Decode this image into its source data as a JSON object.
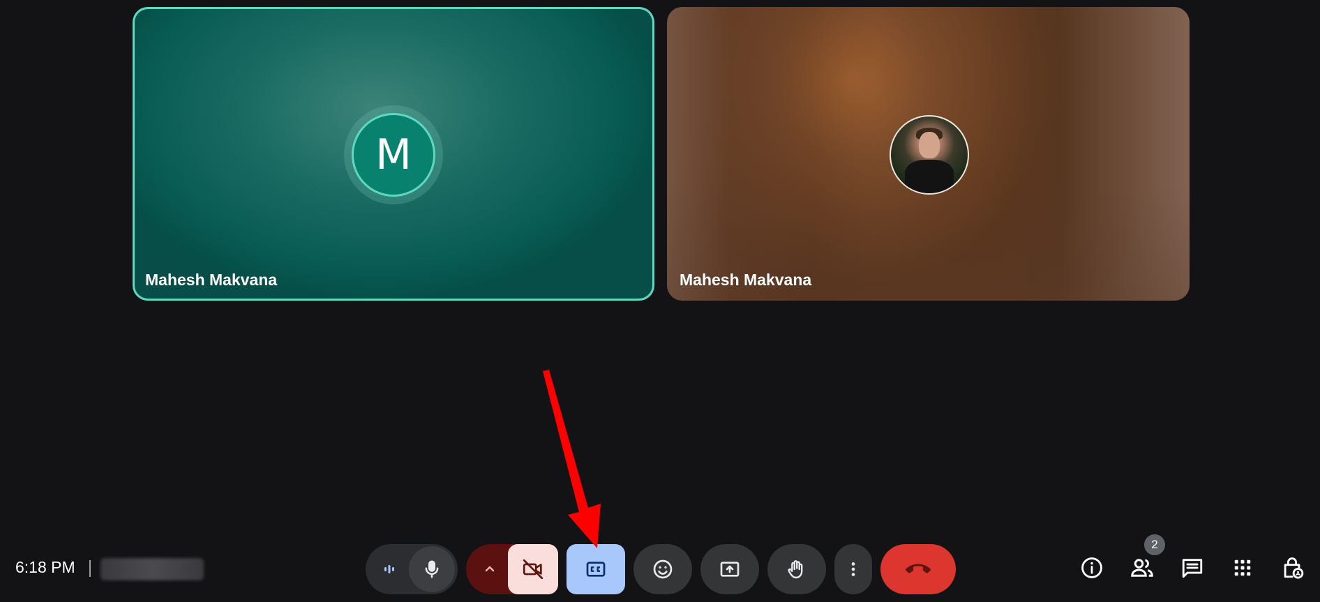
{
  "tiles": [
    {
      "name": "Mahesh Makvana",
      "avatar_letter": "M",
      "active_speaker": true
    },
    {
      "name": "Mahesh Makvana",
      "avatar": "profile-photo"
    }
  ],
  "footer": {
    "time": "6:18 PM",
    "meeting_code": "(blurred)"
  },
  "controls": {
    "mic": {
      "icon": "mic-icon",
      "state": "on"
    },
    "camera": {
      "icon": "videocam-off-icon",
      "state": "off"
    },
    "captions": {
      "icon": "closed-captions-icon",
      "state": "active"
    },
    "reactions": {
      "icon": "emoji-icon"
    },
    "present": {
      "icon": "present-screen-icon"
    },
    "raise_hand": {
      "icon": "raise-hand-icon"
    },
    "more": {
      "icon": "more-vert-icon"
    },
    "leave": {
      "icon": "call-end-icon"
    }
  },
  "side_actions": {
    "info": {
      "icon": "info-icon"
    },
    "people": {
      "icon": "people-icon",
      "badge": "2"
    },
    "chat": {
      "icon": "chat-icon"
    },
    "activities": {
      "icon": "apps-icon"
    },
    "host_controls": {
      "icon": "lock-person-icon"
    }
  },
  "colors": {
    "background": "#131315",
    "accent_teal": "#5fd8bf",
    "leave_red": "#dc362e",
    "captions_active": "#a8c7fa",
    "annotation_arrow": "#ff0000"
  }
}
